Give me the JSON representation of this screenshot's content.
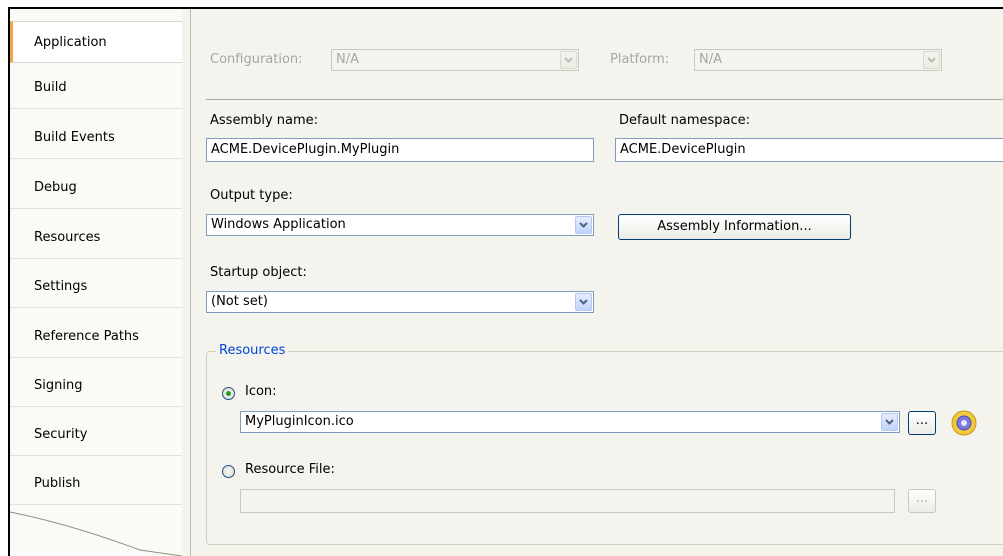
{
  "sidebar": {
    "items": [
      {
        "label": "Application"
      },
      {
        "label": "Build"
      },
      {
        "label": "Build Events"
      },
      {
        "label": "Debug"
      },
      {
        "label": "Resources"
      },
      {
        "label": "Settings"
      },
      {
        "label": "Reference Paths"
      },
      {
        "label": "Signing"
      },
      {
        "label": "Security"
      },
      {
        "label": "Publish"
      }
    ],
    "active_index": 0
  },
  "config": {
    "configuration_label": "Configuration:",
    "configuration_value": "N/A",
    "platform_label": "Platform:",
    "platform_value": "N/A"
  },
  "assembly": {
    "name_label": "Assembly name:",
    "name_value": "ACME.DevicePlugin.MyPlugin",
    "namespace_label": "Default namespace:",
    "namespace_value": "ACME.DevicePlugin"
  },
  "output": {
    "type_label": "Output type:",
    "type_value": "Windows Application",
    "assembly_info_button": "Assembly Information..."
  },
  "startup": {
    "label": "Startup object:",
    "value": "(Not set)"
  },
  "resources": {
    "group_title": "Resources",
    "icon_label": "Icon:",
    "icon_value": "MyPluginIcon.ico",
    "browse_label": "...",
    "resource_file_label": "Resource File:",
    "resource_file_value": "",
    "resource_browse_label": "..."
  },
  "colors": {
    "group_title": "#0046d5",
    "active_tab_accent": "#f2a64a",
    "radio_dot": "#21a121",
    "input_border": "#7f9db9"
  }
}
